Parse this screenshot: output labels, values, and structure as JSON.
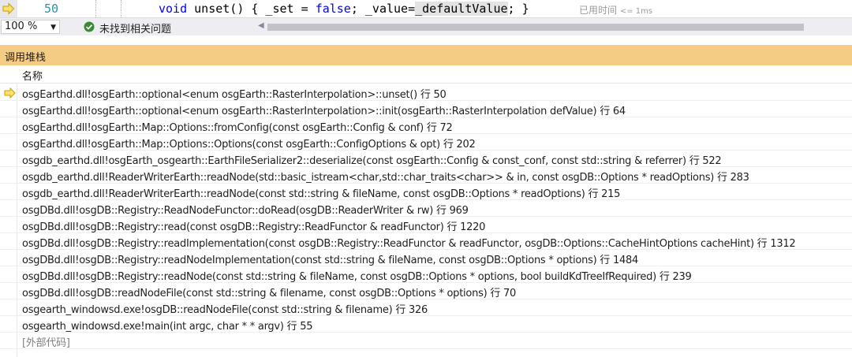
{
  "editor": {
    "line_number": "50",
    "code": {
      "kw_void": "void",
      "part1": " unset() { _set = ",
      "kw_false": "false",
      "part2": "; _value=",
      "highlighted": "_defaultValue",
      "part3": "; }"
    },
    "elapsed_label": "已用时间",
    "elapsed_value": "<= 1ms"
  },
  "status_bar": {
    "zoom": "100 %",
    "issues": "未找到相关问题"
  },
  "call_stack": {
    "title": "调用堆栈",
    "column_name": "名称",
    "frames": [
      "osgEarthd.dll!osgEarth::optional<enum osgEarth::RasterInterpolation>::unset() 行 50",
      "osgEarthd.dll!osgEarth::optional<enum osgEarth::RasterInterpolation>::init(osgEarth::RasterInterpolation defValue) 行 64",
      "osgEarthd.dll!osgEarth::Map::Options::fromConfig(const osgEarth::Config & conf) 行 72",
      "osgEarthd.dll!osgEarth::Map::Options::Options(const osgEarth::ConfigOptions & opt) 行 202",
      "osgdb_earthd.dll!osgEarth_osgearth::EarthFileSerializer2::deserialize(const osgEarth::Config & const_conf, const std::string & referrer) 行 522",
      "osgdb_earthd.dll!ReaderWriterEarth::readNode(std::basic_istream<char,std::char_traits<char>> & in, const osgDB::Options * readOptions) 行 283",
      "osgdb_earthd.dll!ReaderWriterEarth::readNode(const std::string & fileName, const osgDB::Options * readOptions) 行 215",
      "osgDBd.dll!osgDB::Registry::ReadNodeFunctor::doRead(osgDB::ReaderWriter & rw) 行 969",
      "osgDBd.dll!osgDB::Registry::read(const osgDB::Registry::ReadFunctor & readFunctor) 行 1220",
      "osgDBd.dll!osgDB::Registry::readImplementation(const osgDB::Registry::ReadFunctor & readFunctor, osgDB::Options::CacheHintOptions cacheHint) 行 1312",
      "osgDBd.dll!osgDB::Registry::readNodeImplementation(const std::string & fileName, const osgDB::Options * options) 行 1484",
      "osgDBd.dll!osgDB::Registry::readNode(const std::string & fileName, const osgDB::Options * options, bool buildKdTreeIfRequired) 行 239",
      "osgDBd.dll!osgDB::readNodeFile(const std::string & filename, const osgDB::Options * options) 行 70",
      "osgearth_windowsd.exe!osgDB::readNodeFile(const std::string & filename) 行 326",
      "osgearth_windowsd.exe!main(int argc, char * * argv) 行 55",
      "[外部代码]"
    ]
  },
  "colors": {
    "panel_header": "#f5cc84",
    "exec_arrow_fill": "#ffe070",
    "exec_arrow_stroke": "#c8a000",
    "ok_green": "#388a34"
  },
  "icons": {
    "execution_pointer": "arrow-right-icon",
    "issues_ok": "check-circle-icon",
    "zoom_dropdown": "chevron-down-icon",
    "scroll_left": "triangle-left-icon"
  }
}
